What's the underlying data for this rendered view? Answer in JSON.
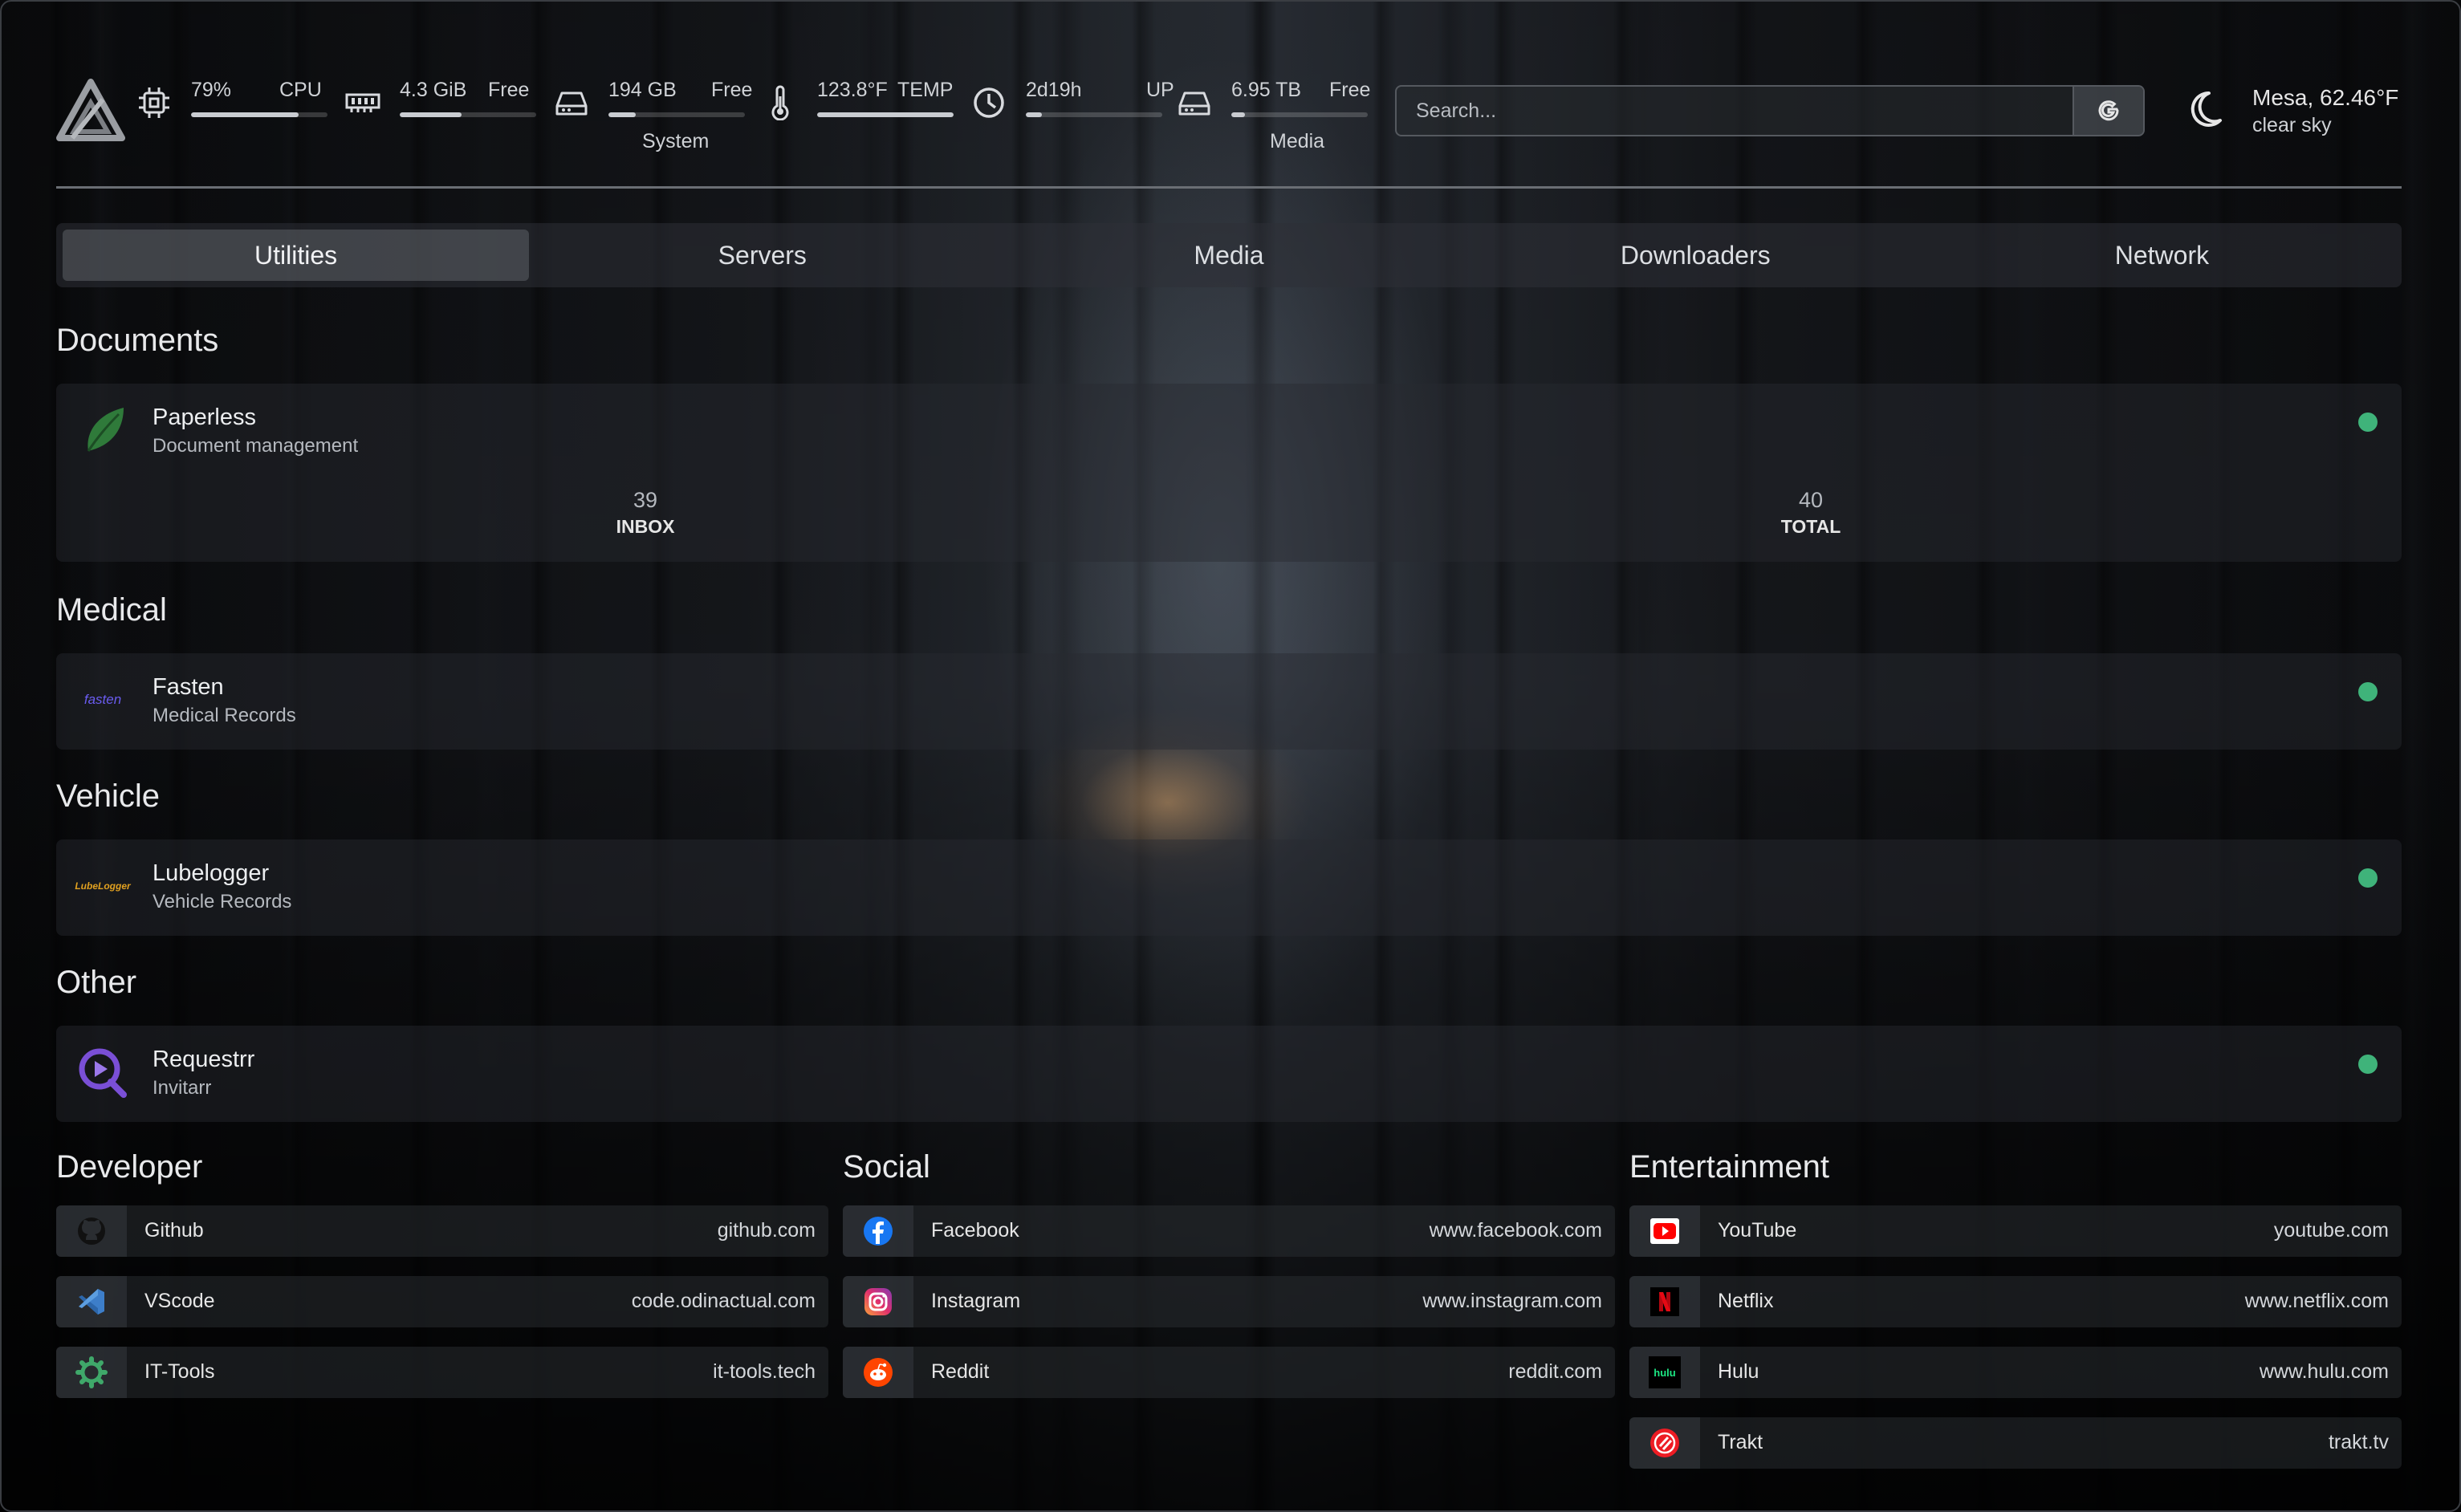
{
  "header": {
    "logo": "homepage-logo",
    "widgets": {
      "cpu": {
        "value": "79%",
        "label": "CPU",
        "percent": 79
      },
      "memory": {
        "value": "4.3 GiB",
        "label": "Free",
        "percent": 45
      },
      "system_disk": {
        "value": "194 GB",
        "label": "Free",
        "percent": 20
      },
      "temp": {
        "value": "123.8°F",
        "label": "TEMP",
        "percent": 100
      },
      "uptime": {
        "value": "2d19h",
        "label": "UP",
        "percent": 12
      },
      "media_disk": {
        "value": "6.95 TB",
        "label": "Free",
        "percent": 10
      }
    },
    "system_label": "System",
    "media_label": "Media",
    "search": {
      "placeholder": "Search..."
    },
    "weather": {
      "location_temp": "Mesa, 62.46°F",
      "condition": "clear sky",
      "icon": "moon-icon"
    }
  },
  "tabs": [
    "Utilities",
    "Servers",
    "Media",
    "Downloaders",
    "Network"
  ],
  "active_tab": "Utilities",
  "groups": {
    "documents": {
      "title": "Documents",
      "services": [
        {
          "name": "Paperless",
          "description": "Document management",
          "status": "online",
          "stats": [
            {
              "value": "39",
              "label": "INBOX"
            },
            {
              "value": "40",
              "label": "TOTAL"
            }
          ]
        }
      ]
    },
    "medical": {
      "title": "Medical",
      "services": [
        {
          "name": "Fasten",
          "description": "Medical Records",
          "status": "online",
          "icon_text": "fasten"
        }
      ]
    },
    "vehicle": {
      "title": "Vehicle",
      "services": [
        {
          "name": "Lubelogger",
          "description": "Vehicle Records",
          "status": "online",
          "icon_text": "LubeLogger"
        }
      ]
    },
    "other": {
      "title": "Other",
      "services": [
        {
          "name": "Requestrr",
          "description": "Invitarr",
          "status": "online"
        }
      ]
    }
  },
  "bookmarks": {
    "developer": {
      "title": "Developer",
      "items": [
        {
          "name": "Github",
          "url": "github.com",
          "icon": "github-icon"
        },
        {
          "name": "VScode",
          "url": "code.odinactual.com",
          "icon": "vscode-icon"
        },
        {
          "name": "IT-Tools",
          "url": "it-tools.tech",
          "icon": "it-tools-icon"
        }
      ]
    },
    "social": {
      "title": "Social",
      "items": [
        {
          "name": "Facebook",
          "url": "www.facebook.com",
          "icon": "facebook-icon"
        },
        {
          "name": "Instagram",
          "url": "www.instagram.com",
          "icon": "instagram-icon"
        },
        {
          "name": "Reddit",
          "url": "reddit.com",
          "icon": "reddit-icon"
        }
      ]
    },
    "entertainment": {
      "title": "Entertainment",
      "items": [
        {
          "name": "YouTube",
          "url": "youtube.com",
          "icon": "youtube-icon"
        },
        {
          "name": "Netflix",
          "url": "www.netflix.com",
          "icon": "netflix-icon"
        },
        {
          "name": "Hulu",
          "url": "www.hulu.com",
          "icon": "hulu-icon",
          "icon_text": "hulu"
        },
        {
          "name": "Trakt",
          "url": "trakt.tv",
          "icon": "trakt-icon"
        }
      ]
    }
  },
  "colors": {
    "status_online": "#3fb37a",
    "accent_purple": "#7a4fd6",
    "divider": "#6a6e74"
  }
}
